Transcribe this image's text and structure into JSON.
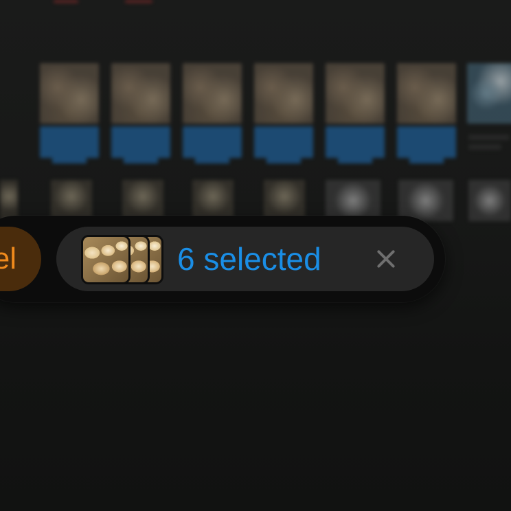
{
  "toolbar": {
    "action_label": "el",
    "selection_count_text": "6 selected",
    "close_icon": "close-icon",
    "thumbnail_icon": "stacked-image-thumbnails"
  },
  "colors": {
    "accent_blue": "#1a8ee6",
    "action_orange": "#f08a1c",
    "action_pill_bg": "#4a2c0c",
    "pill_bg": "#262626",
    "toolbar_bg": "#0c0c0c",
    "page_bg": "#121312"
  }
}
